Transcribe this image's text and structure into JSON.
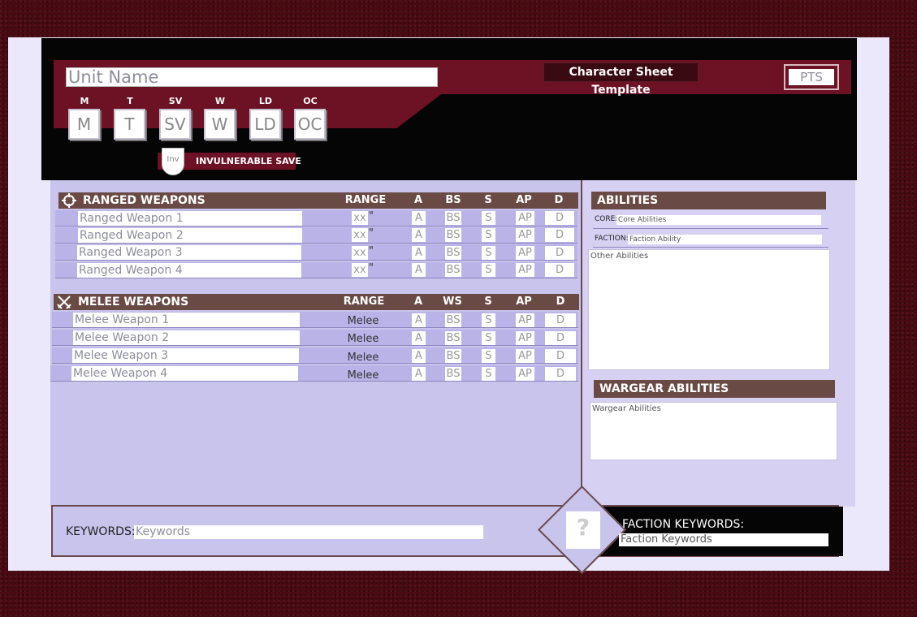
{
  "header": {
    "unit_name": "Unit Name",
    "title": "Character Sheet Template",
    "points": "PTS",
    "stats": [
      {
        "label": "M",
        "value": "M"
      },
      {
        "label": "T",
        "value": "T"
      },
      {
        "label": "SV",
        "value": "SV"
      },
      {
        "label": "W",
        "value": "W"
      },
      {
        "label": "LD",
        "value": "LD"
      },
      {
        "label": "OC",
        "value": "OC"
      }
    ],
    "invuln_value": "Inv",
    "invuln_label": "INVULNERABLE SAVE"
  },
  "ranged": {
    "title": "RANGED WEAPONS",
    "columns": [
      "RANGE",
      "A",
      "BS",
      "S",
      "AP",
      "D"
    ],
    "rows": [
      {
        "name": "Ranged Weapon 1",
        "range": "xx",
        "range_suffix": "\"",
        "a": "A",
        "bs": "BS",
        "s": "S",
        "ap": "AP",
        "d": "D"
      },
      {
        "name": "Ranged Weapon 2",
        "range": "xx",
        "range_suffix": "\"",
        "a": "A",
        "bs": "BS",
        "s": "S",
        "ap": "AP",
        "d": "D"
      },
      {
        "name": "Ranged Weapon 3",
        "range": "xx",
        "range_suffix": "\"",
        "a": "A",
        "bs": "BS",
        "s": "S",
        "ap": "AP",
        "d": "D"
      },
      {
        "name": "Ranged Weapon 4",
        "range": "xx",
        "range_suffix": "\"",
        "a": "A",
        "bs": "BS",
        "s": "S",
        "ap": "AP",
        "d": "D"
      }
    ]
  },
  "melee": {
    "title": "MELEE WEAPONS",
    "columns": [
      "RANGE",
      "A",
      "WS",
      "S",
      "AP",
      "D"
    ],
    "rows": [
      {
        "name": "Melee Weapon 1",
        "range": "Melee",
        "a": "A",
        "bs": "BS",
        "s": "S",
        "ap": "AP",
        "d": "D"
      },
      {
        "name": "Melee Weapon 2",
        "range": "Melee",
        "a": "A",
        "bs": "BS",
        "s": "S",
        "ap": "AP",
        "d": "D"
      },
      {
        "name": "Melee Weapon 3",
        "range": "Melee",
        "a": "A",
        "bs": "BS",
        "s": "S",
        "ap": "AP",
        "d": "D"
      },
      {
        "name": "Melee Weapon 4",
        "range": "Melee",
        "a": "A",
        "bs": "BS",
        "s": "S",
        "ap": "AP",
        "d": "D"
      }
    ]
  },
  "abilities": {
    "title": "ABILITIES",
    "core_label": "CORE:",
    "core_value": "Core Abilities",
    "faction_label": "FACTION:",
    "faction_value": "Faction Ability",
    "other_value": "Other Abilities"
  },
  "wargear": {
    "title": "WARGEAR ABILITIES",
    "value": "Wargear Abilities"
  },
  "footer": {
    "keywords_label": "KEYWORDS:",
    "keywords_value": "Keywords",
    "faction_icon": "?",
    "faction_keywords_label": "FACTION KEYWORDS:",
    "faction_keywords_value": "Faction Keywords"
  },
  "colors": {
    "crimson": "#6c1224",
    "section_header": "#6a4a44",
    "panel": "#c9c4ec",
    "sheet": "#ece8fb"
  },
  "icons": {
    "ranged": "crosshair-icon",
    "melee": "crossed-swords-icon"
  }
}
